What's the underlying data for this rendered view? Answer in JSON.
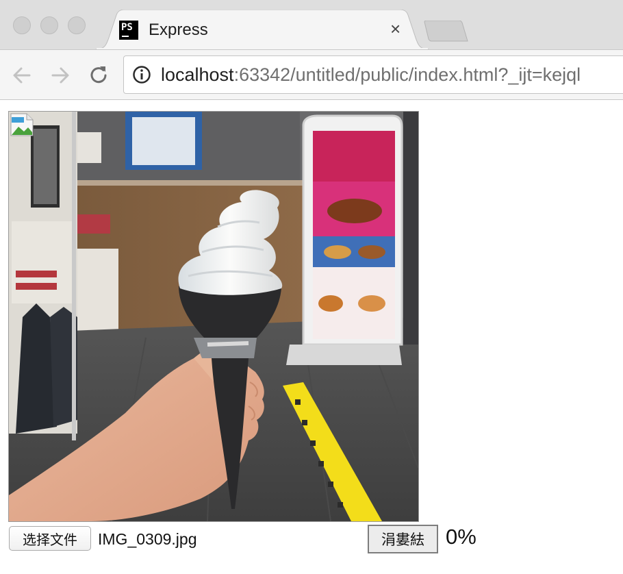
{
  "window": {
    "traffic_lights": [
      "close",
      "minimize",
      "zoom"
    ]
  },
  "tab": {
    "favicon_icon": "phpstorm-icon",
    "favicon_text": "PS",
    "title": "Express",
    "close_glyph": "×"
  },
  "toolbar": {
    "back_icon": "back-arrow-icon",
    "forward_icon": "forward-arrow-icon",
    "reload_icon": "reload-icon",
    "site_info_icon": "info-icon",
    "url_host": "localhost",
    "url_rest": ":63342/untitled/public/index.html?_ijt=kejql"
  },
  "page": {
    "preview_image": {
      "alt": "",
      "status_icon": "broken-image-icon",
      "depicts": "hand-holding-soft-serve-ice-cream-cone"
    },
    "choose_file_label": "选择文件",
    "file_name": "IMG_0309.jpg",
    "submit_label": "涓婁紶",
    "progress_text": "0%"
  },
  "colors": {
    "tabbar_bg": "#dedede",
    "toolbar_bg": "#f5f5f5",
    "url_host": "#1e1e1e",
    "url_rest": "#6f6f6f",
    "floor_tape": "#f3dd1a"
  }
}
